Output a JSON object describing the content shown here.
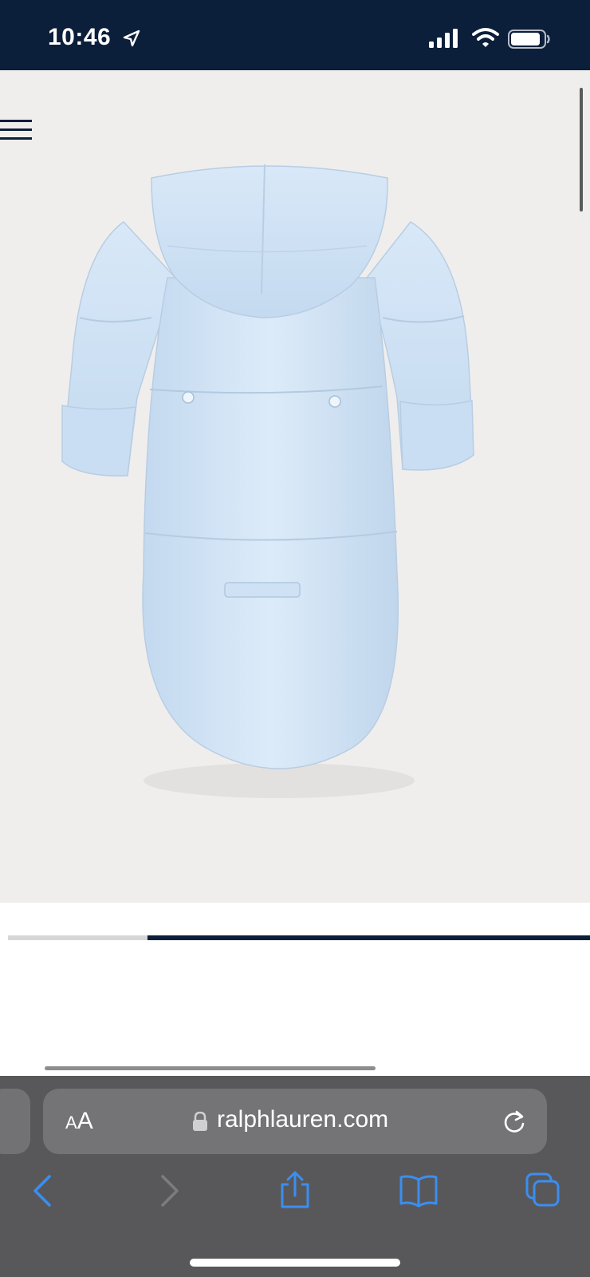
{
  "status_bar": {
    "time": "10:46",
    "icons": [
      "location-arrow-icon",
      "cellular-signal-icon",
      "wifi-icon",
      "battery-icon"
    ]
  },
  "product": {
    "image_description_icon": "infant-bunting-snowsuit-back-view",
    "colors": {
      "fabric": "#cfe3f6",
      "background": "#efeeed"
    }
  },
  "carousel": {
    "progress": 0.76
  },
  "browser": {
    "text_size_label_small": "A",
    "text_size_label_large": "A",
    "url": "ralphlauren.com",
    "toolbar_buttons": [
      "back",
      "forward",
      "share",
      "bookmarks",
      "tabs"
    ]
  },
  "colors": {
    "navy": "#0b1e3a",
    "ios_blue": "#3b8ef0",
    "toolbar": "#58585a"
  }
}
